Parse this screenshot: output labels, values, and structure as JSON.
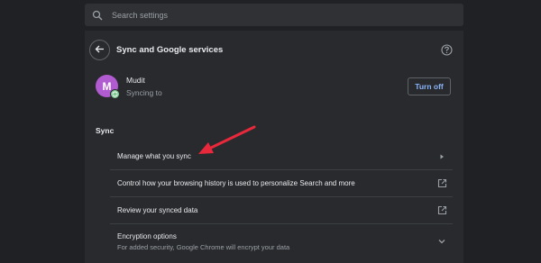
{
  "search": {
    "placeholder": "Search settings"
  },
  "header": {
    "title": "Sync and Google services"
  },
  "account": {
    "avatar_letter": "M",
    "name": "Mudit",
    "status": "Syncing to",
    "turn_off_label": "Turn off"
  },
  "sync_section": {
    "title": "Sync",
    "items": [
      {
        "label": "Manage what you sync",
        "trail_icon": "chevron-right-icon"
      },
      {
        "label": "Control how your browsing history is used to personalize Search and more",
        "trail_icon": "external-link-icon"
      },
      {
        "label": "Review your synced data",
        "trail_icon": "external-link-icon"
      },
      {
        "label": "Encryption options",
        "sublabel": "For added security, Google Chrome will encrypt your data",
        "trail_icon": "chevron-down-icon"
      }
    ]
  },
  "colors": {
    "background": "#202124",
    "card": "#292a2d",
    "accent": "#8ab4f8",
    "avatar": "#b15bd0",
    "annotation_arrow": "#e8283b"
  }
}
